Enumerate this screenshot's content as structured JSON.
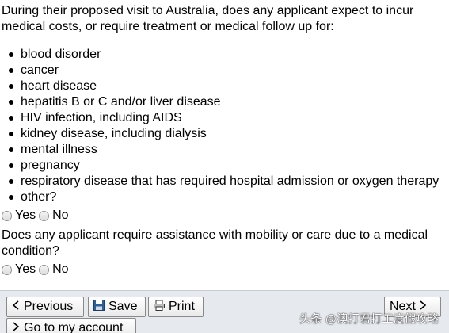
{
  "question1": {
    "text": "During their proposed visit to Australia, does any applicant expect to incur medical costs, or require treatment or medical follow up for:",
    "items": [
      "blood disorder",
      "cancer",
      "heart disease",
      "hepatitis B or C and/or liver disease",
      "HIV infection, including AIDS",
      "kidney disease, including dialysis",
      "mental illness",
      "pregnancy",
      "respiratory disease that has required hospital admission or oxygen therapy",
      "other?"
    ],
    "yes_label": "Yes",
    "no_label": "No"
  },
  "question2": {
    "text": "Does any applicant require assistance with mobility or care due to a medical condition?",
    "yes_label": "Yes",
    "no_label": "No"
  },
  "buttons": {
    "previous": "Previous",
    "save": "Save",
    "print": "Print",
    "next": "Next",
    "account": "Go to my account"
  },
  "watermark": "头条 @澳打君打工度假攻略",
  "colors": {
    "button_bar": "#e6eaef",
    "text": "#000000"
  }
}
